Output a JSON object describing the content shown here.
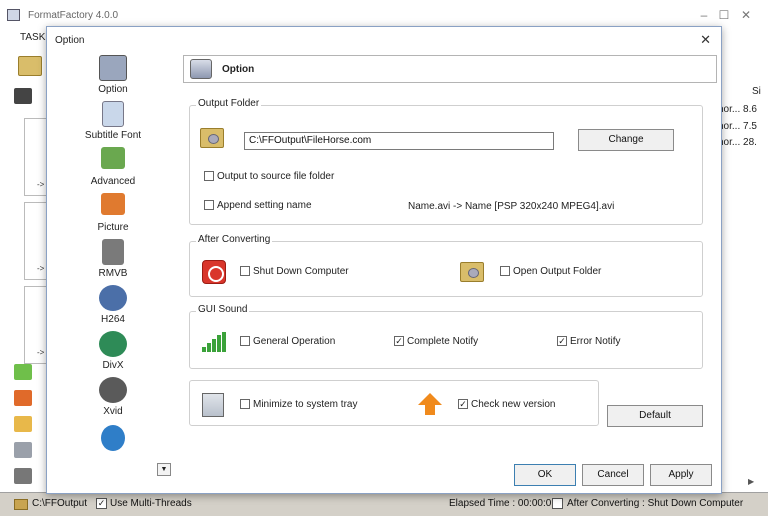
{
  "app": {
    "title": "FormatFactory 4.0.0",
    "task_label": "TASK"
  },
  "right_list": {
    "header": "Si",
    "rows": [
      "hor... 8.6",
      "hor... 7.5",
      "hor... 28."
    ]
  },
  "side_arrows": [
    "->",
    "->",
    "->"
  ],
  "statusbar": {
    "output_path": "C:\\FFOutput",
    "multithread_label": "Use Multi-Threads",
    "multithread_checked": true,
    "elapsed": "Elapsed Time : 00:00:01",
    "after_converting": "After Converting : Shut Down Computer",
    "after_converting_checked": false
  },
  "dialog": {
    "title": "Option",
    "close_glyph": "✕",
    "nav_items": [
      {
        "label": "Option",
        "icon": "option-icon",
        "color": "#9aa6bd"
      },
      {
        "label": "Subtitle Font",
        "icon": "subtitle-font-icon",
        "color": "#c9d7ea"
      },
      {
        "label": "Advanced",
        "icon": "advanced-icon",
        "color": "#6aa84f"
      },
      {
        "label": "Picture",
        "icon": "picture-icon",
        "color": "#e07a2f"
      },
      {
        "label": "RMVB",
        "icon": "rmvb-icon",
        "color": "#7a7a7a"
      },
      {
        "label": "H264",
        "icon": "h264-icon",
        "color": "#4b6fa8"
      },
      {
        "label": "DivX",
        "icon": "divx-icon",
        "color": "#2e8b57"
      },
      {
        "label": "Xvid",
        "icon": "xvid-icon",
        "color": "#5a5a5a"
      },
      {
        "label": "",
        "icon": "media-icon",
        "color": "#2f7ec8"
      }
    ],
    "header_title": "Option",
    "output_folder": {
      "title": "Output Folder",
      "path": "C:\\FFOutput\\FileHorse.com",
      "change_label": "Change",
      "output_to_source": "Output to source file folder",
      "append_setting": "Append setting name",
      "append_example": "Name.avi  -> Name [PSP 320x240 MPEG4].avi"
    },
    "after_converting": {
      "title": "After Converting",
      "shutdown_label": "Shut Down Computer",
      "open_folder_label": "Open Output Folder"
    },
    "gui_sound": {
      "title": "GUI Sound",
      "general": {
        "label": "General Operation",
        "checked": false
      },
      "complete": {
        "label": "Complete Notify",
        "checked": true
      },
      "error": {
        "label": "Error Notify",
        "checked": true
      }
    },
    "misc": {
      "minimize_label": "Minimize to system tray",
      "minimize_checked": false,
      "check_version_label": "Check new version",
      "check_version_checked": true,
      "default_label": "Default"
    },
    "buttons": {
      "ok": "OK",
      "cancel": "Cancel",
      "apply": "Apply"
    }
  }
}
